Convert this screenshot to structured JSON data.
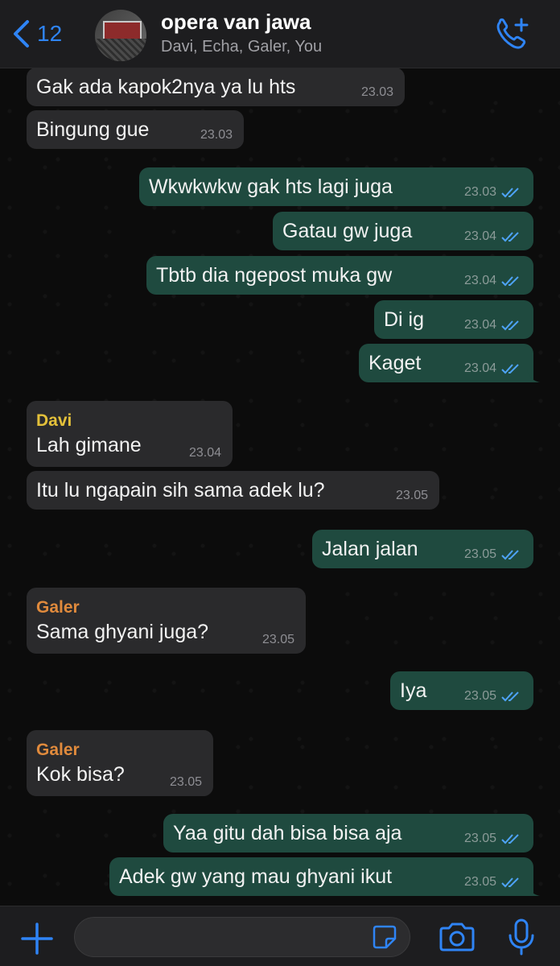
{
  "header": {
    "back_count": "12",
    "title": "opera van jawa",
    "subtitle": "Davi, Echa, Galer, You"
  },
  "messages": [
    {
      "text": "Gak ada kapok2nya ya lu hts",
      "time": "23.03",
      "dir": "in"
    },
    {
      "text": "Bingung gue",
      "time": "23.03",
      "dir": "in"
    },
    {
      "text": "Wkwkwkw gak hts lagi juga",
      "time": "23.03",
      "dir": "out",
      "status": "read"
    },
    {
      "text": "Gatau gw juga",
      "time": "23.04",
      "dir": "out",
      "status": "read"
    },
    {
      "text": "Tbtb dia ngepost muka gw",
      "time": "23.04",
      "dir": "out",
      "status": "read"
    },
    {
      "text": "Di ig",
      "time": "23.04",
      "dir": "out",
      "status": "read"
    },
    {
      "text": "Kaget",
      "time": "23.04",
      "dir": "out",
      "status": "read"
    },
    {
      "sender": "Davi",
      "sender_color": "#e3c03a",
      "text": "Lah gimane",
      "time": "23.04",
      "dir": "in"
    },
    {
      "text": "Itu lu ngapain sih sama adek lu?",
      "time": "23.05",
      "dir": "in"
    },
    {
      "text": "Jalan jalan",
      "time": "23.05",
      "dir": "out",
      "status": "read"
    },
    {
      "sender": "Galer",
      "sender_color": "#e08a3c",
      "text": "Sama ghyani juga?",
      "time": "23.05",
      "dir": "in"
    },
    {
      "text": "Iya",
      "time": "23.05",
      "dir": "out",
      "status": "read"
    },
    {
      "sender": "Galer",
      "sender_color": "#e08a3c",
      "text": "Kok bisa?",
      "time": "23.05",
      "dir": "in"
    },
    {
      "text": "Yaa gitu dah bisa bisa aja",
      "time": "23.05",
      "dir": "out",
      "status": "read"
    },
    {
      "text": "Adek gw yang mau ghyani ikut",
      "time": "23.05",
      "dir": "out",
      "status": "read"
    }
  ],
  "composer": {
    "placeholder": ""
  },
  "icons": {
    "back": "chevron-left-icon",
    "call": "phone-plus-icon",
    "attach": "plus-icon",
    "sticker": "sticker-icon",
    "camera": "camera-icon",
    "mic": "microphone-icon",
    "read": "double-check-icon"
  },
  "colors": {
    "accent": "#2f84f5",
    "outgoing_bubble": "#1f4a3f",
    "incoming_bubble": "#2a2a2c",
    "read_ticks": "#4ea3f7"
  }
}
